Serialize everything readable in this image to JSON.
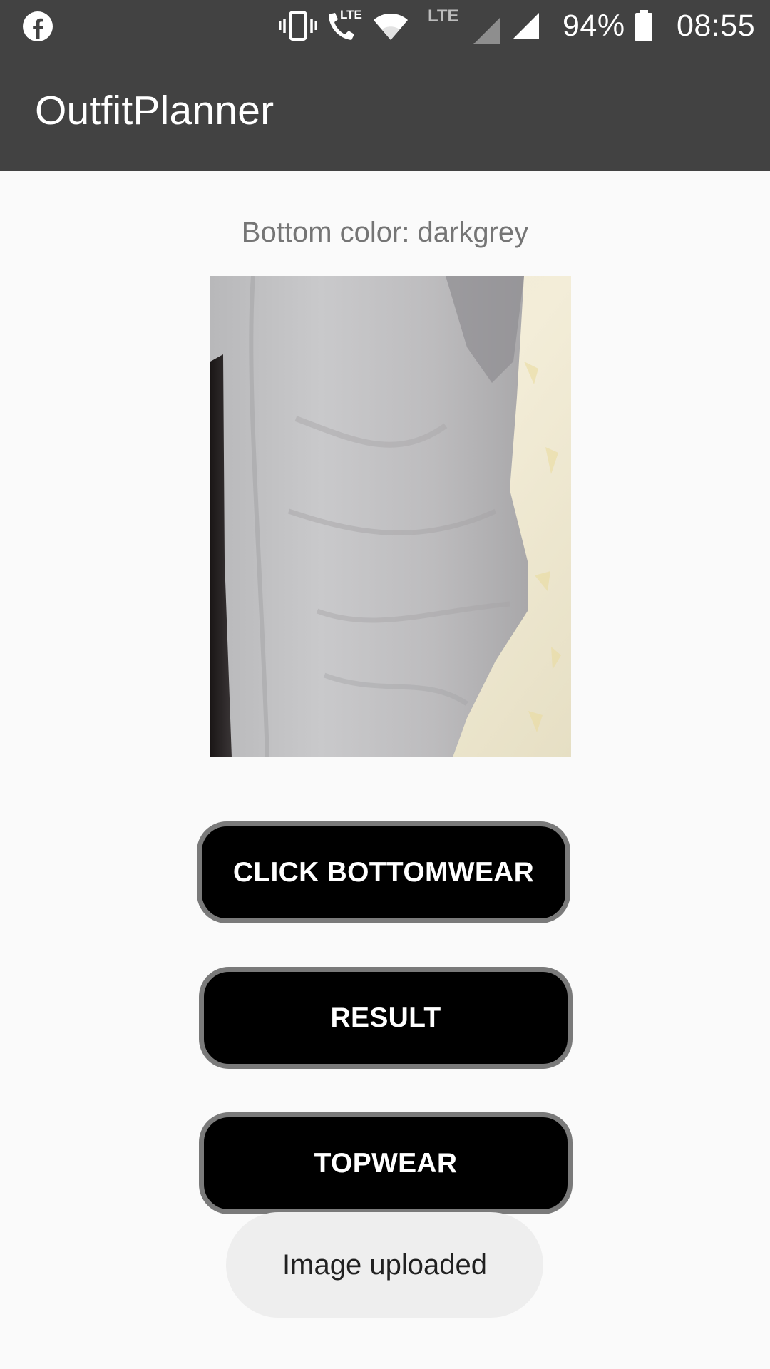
{
  "status_bar": {
    "left_icon": "facebook-icon",
    "icons": [
      "vibrate-icon",
      "volte-call-icon",
      "wifi-icon",
      "lte-signal-icon",
      "signal-icon",
      "battery-icon"
    ],
    "lte_label_1": "LTE",
    "lte_label_2": "LTE",
    "battery_percent": "94%",
    "time": "08:55"
  },
  "app_bar": {
    "title": "OutfitPlanner"
  },
  "main": {
    "color_label": "Bottom color: darkgrey",
    "image_icon": "clothing-photo",
    "buttons": [
      {
        "label": "CLICK BOTTOMWEAR"
      },
      {
        "label": "RESULT"
      },
      {
        "label": "TOPWEAR"
      }
    ]
  },
  "toast": {
    "message": "Image uploaded"
  },
  "colors": {
    "bar": "#424242",
    "background": "#fafafa",
    "button": "#000000",
    "button_border": "#7a7a7a",
    "toast": "#eeeeee"
  }
}
